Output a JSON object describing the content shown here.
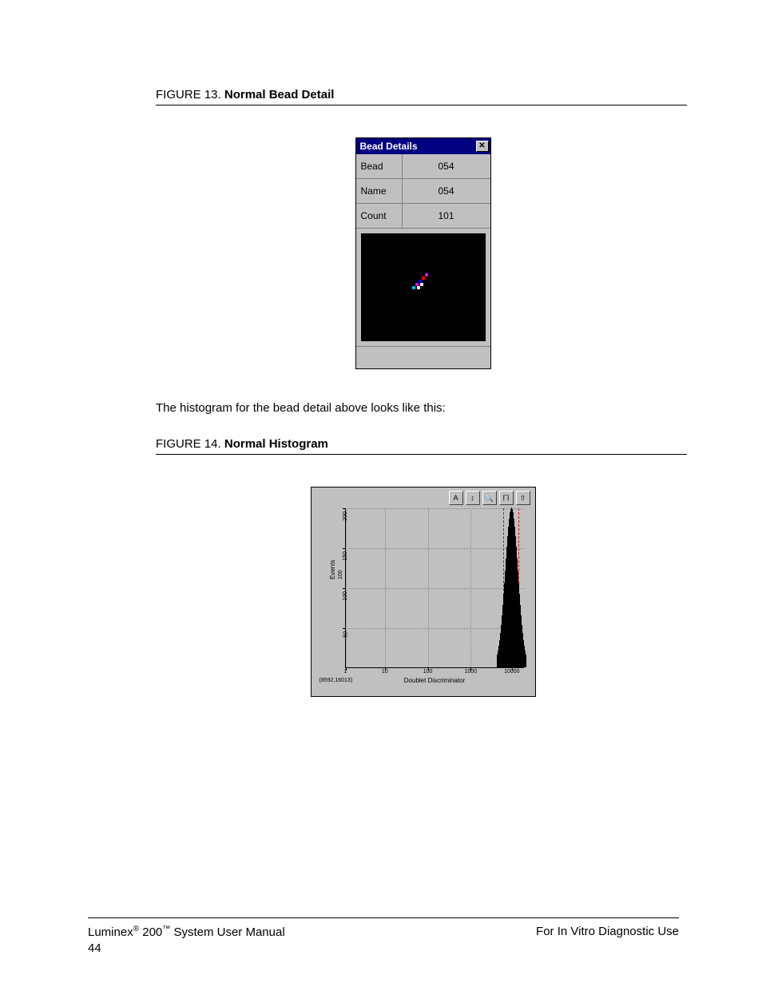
{
  "figure13": {
    "prefix": "FIGURE 13.",
    "title": "Normal Bead Detail"
  },
  "beadDialog": {
    "title": "Bead Details",
    "close": "✕",
    "rows": {
      "bead": {
        "label": "Bead",
        "value": "054"
      },
      "name": {
        "label": "Name",
        "value": "054"
      },
      "count": {
        "label": "Count",
        "value": "101"
      }
    },
    "scatter": [
      {
        "left": 64,
        "top": 66,
        "color": "#00bfff"
      },
      {
        "left": 68,
        "top": 62,
        "color": "#ff00ff"
      },
      {
        "left": 72,
        "top": 58,
        "color": "#0000ff"
      },
      {
        "left": 76,
        "top": 54,
        "color": "#ff0000"
      },
      {
        "left": 80,
        "top": 50,
        "color": "#ff00ff"
      },
      {
        "left": 70,
        "top": 66,
        "color": "#ffffff"
      },
      {
        "left": 74,
        "top": 62,
        "color": "#ffffff"
      }
    ]
  },
  "bodyText": "The histogram for the bead detail above looks like this:",
  "figure14": {
    "prefix": "FIGURE 14.",
    "title": "Normal Histogram"
  },
  "histogram": {
    "toolbar": [
      "A",
      "↕",
      "🔍",
      "⨅",
      "⇧"
    ],
    "origin_label": "(8592,16013)",
    "xlabel": "Doublet Discriminator",
    "ylabel": "Events",
    "xticks": [
      {
        "pos": 0.0,
        "label": "1"
      },
      {
        "pos": 0.22,
        "label": "10"
      },
      {
        "pos": 0.46,
        "label": "100"
      },
      {
        "pos": 0.7,
        "label": "1000"
      },
      {
        "pos": 0.93,
        "label": "10000"
      }
    ],
    "yticks": [
      {
        "pos": 0.25,
        "label": "50"
      },
      {
        "pos": 0.5,
        "label": "100"
      },
      {
        "pos": 0.75,
        "label": "150"
      },
      {
        "pos": 1.0,
        "label": "200"
      }
    ],
    "gates": [
      0.88,
      0.965
    ]
  },
  "chart_data": {
    "type": "bar",
    "title": "",
    "xlabel": "Doublet Discriminator",
    "ylabel": "Events",
    "x_scale": "log",
    "xlim": [
      1,
      20000
    ],
    "ylim": [
      0,
      200
    ],
    "gate_range": [
      8592,
      16013
    ],
    "series": [
      {
        "name": "Events",
        "description": "Single narrow histogram peak centered near x≈11000 within the gated Doublet Discriminator range, peak height ≈200 events; counts fall to ~0 outside roughly 8000–16000.",
        "peak_x_approx": 11000,
        "peak_height_approx": 200
      }
    ]
  },
  "footer": {
    "left_parts": {
      "a": "Luminex",
      "sup1": "®",
      "b": " 200",
      "sup2": "™",
      "c": " System User Manual"
    },
    "right": "For In Vitro Diagnostic Use",
    "page": "44"
  }
}
